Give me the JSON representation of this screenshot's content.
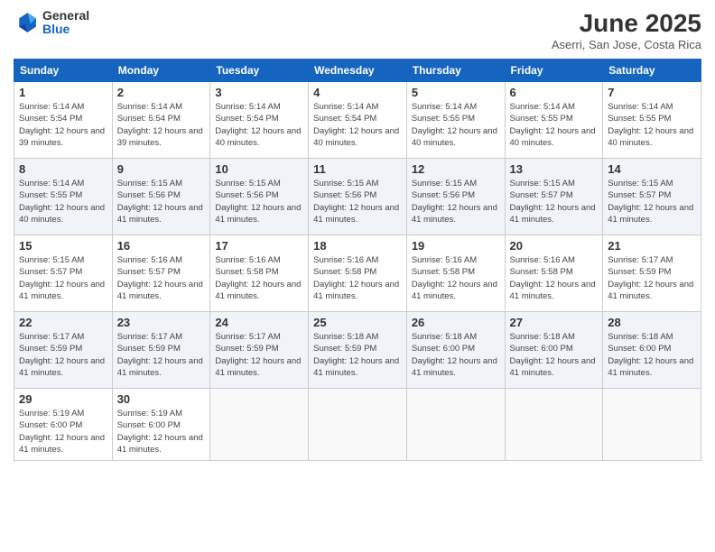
{
  "header": {
    "logo_general": "General",
    "logo_blue": "Blue",
    "title": "June 2025",
    "subtitle": "Aserri, San Jose, Costa Rica"
  },
  "weekdays": [
    "Sunday",
    "Monday",
    "Tuesday",
    "Wednesday",
    "Thursday",
    "Friday",
    "Saturday"
  ],
  "weeks": [
    [
      {
        "day": "1",
        "sunrise": "5:14 AM",
        "sunset": "5:54 PM",
        "daylight": "12 hours and 39 minutes."
      },
      {
        "day": "2",
        "sunrise": "5:14 AM",
        "sunset": "5:54 PM",
        "daylight": "12 hours and 39 minutes."
      },
      {
        "day": "3",
        "sunrise": "5:14 AM",
        "sunset": "5:54 PM",
        "daylight": "12 hours and 40 minutes."
      },
      {
        "day": "4",
        "sunrise": "5:14 AM",
        "sunset": "5:54 PM",
        "daylight": "12 hours and 40 minutes."
      },
      {
        "day": "5",
        "sunrise": "5:14 AM",
        "sunset": "5:55 PM",
        "daylight": "12 hours and 40 minutes."
      },
      {
        "day": "6",
        "sunrise": "5:14 AM",
        "sunset": "5:55 PM",
        "daylight": "12 hours and 40 minutes."
      },
      {
        "day": "7",
        "sunrise": "5:14 AM",
        "sunset": "5:55 PM",
        "daylight": "12 hours and 40 minutes."
      }
    ],
    [
      {
        "day": "8",
        "sunrise": "5:14 AM",
        "sunset": "5:55 PM",
        "daylight": "12 hours and 40 minutes."
      },
      {
        "day": "9",
        "sunrise": "5:15 AM",
        "sunset": "5:56 PM",
        "daylight": "12 hours and 41 minutes."
      },
      {
        "day": "10",
        "sunrise": "5:15 AM",
        "sunset": "5:56 PM",
        "daylight": "12 hours and 41 minutes."
      },
      {
        "day": "11",
        "sunrise": "5:15 AM",
        "sunset": "5:56 PM",
        "daylight": "12 hours and 41 minutes."
      },
      {
        "day": "12",
        "sunrise": "5:15 AM",
        "sunset": "5:56 PM",
        "daylight": "12 hours and 41 minutes."
      },
      {
        "day": "13",
        "sunrise": "5:15 AM",
        "sunset": "5:57 PM",
        "daylight": "12 hours and 41 minutes."
      },
      {
        "day": "14",
        "sunrise": "5:15 AM",
        "sunset": "5:57 PM",
        "daylight": "12 hours and 41 minutes."
      }
    ],
    [
      {
        "day": "15",
        "sunrise": "5:15 AM",
        "sunset": "5:57 PM",
        "daylight": "12 hours and 41 minutes."
      },
      {
        "day": "16",
        "sunrise": "5:16 AM",
        "sunset": "5:57 PM",
        "daylight": "12 hours and 41 minutes."
      },
      {
        "day": "17",
        "sunrise": "5:16 AM",
        "sunset": "5:58 PM",
        "daylight": "12 hours and 41 minutes."
      },
      {
        "day": "18",
        "sunrise": "5:16 AM",
        "sunset": "5:58 PM",
        "daylight": "12 hours and 41 minutes."
      },
      {
        "day": "19",
        "sunrise": "5:16 AM",
        "sunset": "5:58 PM",
        "daylight": "12 hours and 41 minutes."
      },
      {
        "day": "20",
        "sunrise": "5:16 AM",
        "sunset": "5:58 PM",
        "daylight": "12 hours and 41 minutes."
      },
      {
        "day": "21",
        "sunrise": "5:17 AM",
        "sunset": "5:59 PM",
        "daylight": "12 hours and 41 minutes."
      }
    ],
    [
      {
        "day": "22",
        "sunrise": "5:17 AM",
        "sunset": "5:59 PM",
        "daylight": "12 hours and 41 minutes."
      },
      {
        "day": "23",
        "sunrise": "5:17 AM",
        "sunset": "5:59 PM",
        "daylight": "12 hours and 41 minutes."
      },
      {
        "day": "24",
        "sunrise": "5:17 AM",
        "sunset": "5:59 PM",
        "daylight": "12 hours and 41 minutes."
      },
      {
        "day": "25",
        "sunrise": "5:18 AM",
        "sunset": "5:59 PM",
        "daylight": "12 hours and 41 minutes."
      },
      {
        "day": "26",
        "sunrise": "5:18 AM",
        "sunset": "6:00 PM",
        "daylight": "12 hours and 41 minutes."
      },
      {
        "day": "27",
        "sunrise": "5:18 AM",
        "sunset": "6:00 PM",
        "daylight": "12 hours and 41 minutes."
      },
      {
        "day": "28",
        "sunrise": "5:18 AM",
        "sunset": "6:00 PM",
        "daylight": "12 hours and 41 minutes."
      }
    ],
    [
      {
        "day": "29",
        "sunrise": "5:19 AM",
        "sunset": "6:00 PM",
        "daylight": "12 hours and 41 minutes."
      },
      {
        "day": "30",
        "sunrise": "5:19 AM",
        "sunset": "6:00 PM",
        "daylight": "12 hours and 41 minutes."
      },
      null,
      null,
      null,
      null,
      null
    ]
  ]
}
